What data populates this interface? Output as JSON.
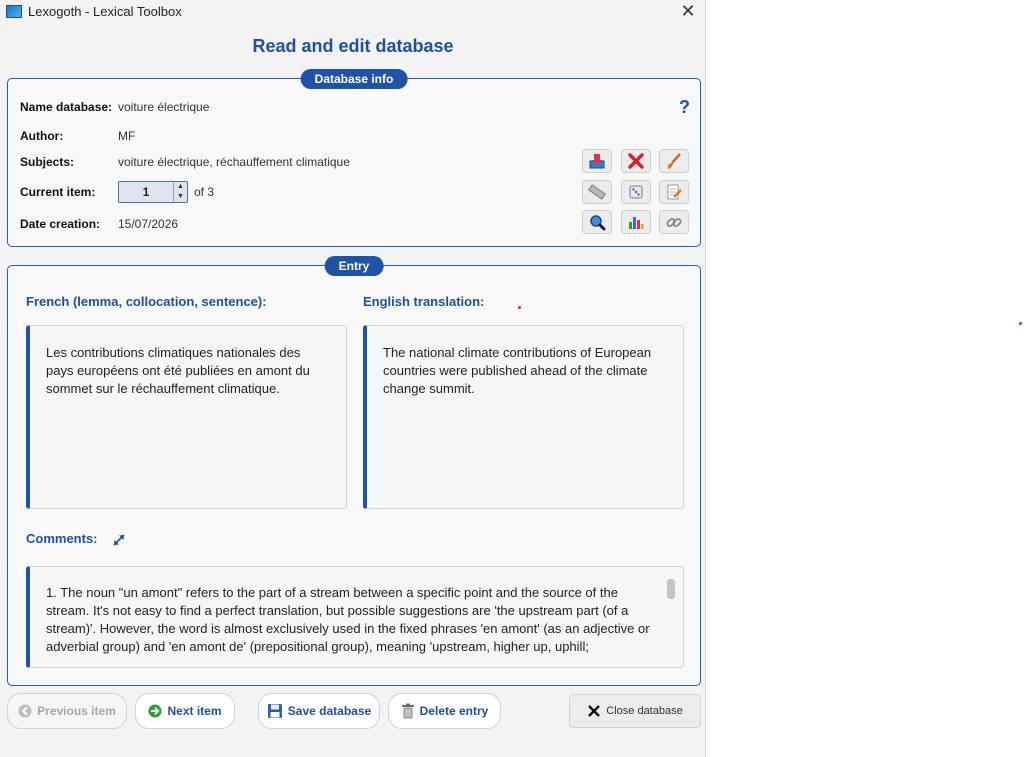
{
  "window": {
    "title": "Lexogoth - Lexical Toolbox",
    "close_glyph": "✕"
  },
  "page_title": "Read and edit database",
  "database_info": {
    "section_label": "Database info",
    "help_glyph": "?",
    "name_label": "Name database:",
    "name_value": "voiture électrique",
    "author_label": "Author:",
    "author_value": "MF",
    "subjects_label": "Subjects:",
    "subjects_value": "voiture électrique, réchauffement climatique",
    "current_item_label": "Current item:",
    "current_item_value": "1",
    "of_text": "of 3",
    "date_label": "Date creation:",
    "date_value": "15/07/2026"
  },
  "toolbar_icons": [
    "import-icon",
    "delete-x-icon",
    "brush-icon",
    "ruler-icon",
    "dice-icon",
    "edit-note-icon",
    "search-icon",
    "chart-icon",
    "link-icon"
  ],
  "entry": {
    "section_label": "Entry",
    "french_label": "French (lemma, collocation, sentence):",
    "english_label": "English translation:",
    "french_text": "Les contributions climatiques nationales des pays européens ont été publiées en amont du sommet sur le réchauffement climatique.",
    "english_text": "The national climate contributions of European countries were published ahead of the climate change summit.",
    "comments_label": "Comments:",
    "comments_text": "1. The noun \"un amont\" refers to the part of a stream between a specific point and the source of the stream. It's not easy to find a perfect translation, but possible suggestions are 'the upstream part (of a stream)'. However, the word is almost exclusively used in the fixed phrases 'en amont' (as an adjective or adverbial group) and 'en amont de' (prepositional group), meaning 'upstream, higher up, uphill;"
  },
  "buttons": {
    "previous": "Previous item",
    "next": "Next item",
    "save": "Save database",
    "delete": "Delete entry",
    "close": "Close database"
  },
  "colors": {
    "accent": "#1f53a8",
    "title_blue": "#1e4fa3",
    "danger": "#e0202a"
  }
}
